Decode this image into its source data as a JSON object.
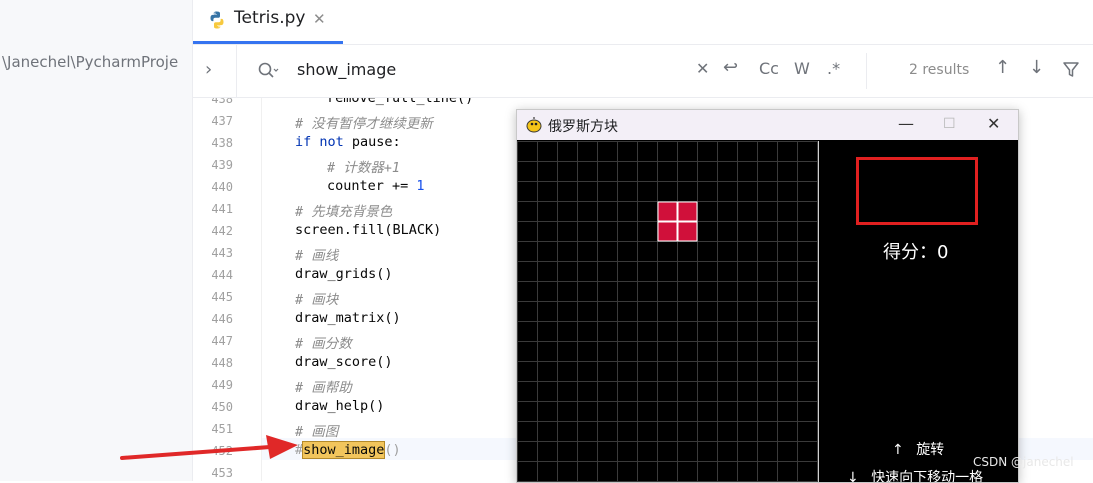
{
  "project_panel": {
    "path_text": "\\Janechel\\PycharmProje"
  },
  "tab": {
    "label": "Tetris.py",
    "close_glyph": "✕"
  },
  "search": {
    "chevron": "›",
    "query": "show_image",
    "clear_glyph": "✕",
    "replace_glyph": "↩",
    "match_case": "Cc",
    "whole_word": "W",
    "regex": ".*",
    "results": "2 results",
    "prev_glyph": "↑",
    "next_glyph": "↓",
    "filter_glyph": "⊽"
  },
  "editor": {
    "lines": [
      {
        "num": "438",
        "text": "remove_full_line()"
      },
      {
        "num": "437",
        "comment": "# 没有暂停才继续更新"
      },
      {
        "num": "438",
        "kw": "if not",
        "rest": " pause:"
      },
      {
        "num": "439",
        "comment": "# 计数器+1"
      },
      {
        "num": "440",
        "code": "counter += ",
        "num_lit": "1"
      },
      {
        "num": "441",
        "comment": "# 先填充背景色"
      },
      {
        "num": "442",
        "text": "screen.fill(BLACK)"
      },
      {
        "num": "443",
        "comment": "# 画线"
      },
      {
        "num": "444",
        "text": "draw_grids()"
      },
      {
        "num": "445",
        "comment": "# 画块"
      },
      {
        "num": "446",
        "text": "draw_matrix()"
      },
      {
        "num": "447",
        "comment": "# 画分数"
      },
      {
        "num": "448",
        "text": "draw_score()"
      },
      {
        "num": "449",
        "comment": "# 画帮助"
      },
      {
        "num": "450",
        "text": "draw_help()"
      },
      {
        "num": "451",
        "comment": "# 画图"
      },
      {
        "num": "452",
        "hash": "#",
        "match": "show_image",
        "tail": "()"
      },
      {
        "num": "453",
        "text": ""
      }
    ]
  },
  "game_window": {
    "title": "俄罗斯方块",
    "minimize": "—",
    "maximize": "☐",
    "close": "✕",
    "score_text": "得分：0",
    "help": [
      {
        "key": "↑",
        "action": "旋转"
      },
      {
        "key": "↓",
        "action": "快速向下移动一格"
      }
    ],
    "block_color": "#d0103a",
    "grid_color": "#3a3a3a",
    "preview_border_color": "#e02020"
  },
  "watermark": "CSDN @janechel",
  "colors": {
    "annotation_arrow": "#e02828",
    "accent": "#3574f0"
  }
}
